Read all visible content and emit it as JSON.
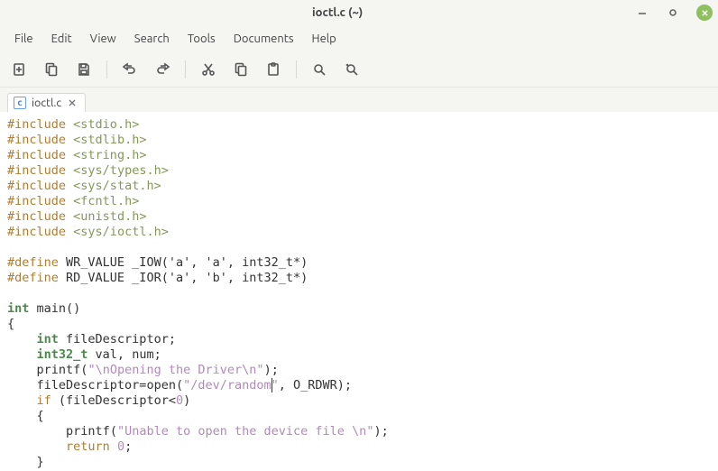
{
  "window": {
    "title": "ioctl.c (~)"
  },
  "menu": {
    "file": "File",
    "edit": "Edit",
    "view": "View",
    "search": "Search",
    "tools": "Tools",
    "documents": "Documents",
    "help": "Help"
  },
  "tab": {
    "icon_letter": "c",
    "label": "ioctl.c"
  },
  "code": {
    "include": "#include",
    "define": "#define",
    "inc_stdio": "<stdio.h>",
    "inc_stdlib": "<stdlib.h>",
    "inc_string": "<string.h>",
    "inc_types": "<sys/types.h>",
    "inc_stat": "<sys/stat.h>",
    "inc_fcntl": "<fcntl.h>",
    "inc_unistd": "<unistd.h>",
    "inc_ioctl": "<sys/ioctl.h>",
    "def_wr": " WR_VALUE _IOW('a', 'a', int32_t*)",
    "def_rd": " RD_VALUE _IOR('a', 'b', int32_t*)",
    "kw_int": "int",
    "kw_int32": "int32_t",
    "kw_if": "if",
    "kw_return": "return",
    "id_main": " main()",
    "brace_open": "{",
    "brace_close": "}",
    "indent1": "    ",
    "indent2": "        ",
    "decl_fd": " fileDescriptor;",
    "decl_val": " val, num;",
    "printf": "printf",
    "open": "open",
    "str_open_driver_pre": "\"",
    "esc_n": "\\n",
    "str_open_driver_mid": "Opening the Driver",
    "str_open_driver_post": "\"",
    "printf_open_tail": ");",
    "assign_fd_pre": "fileDescriptor=",
    "assign_fd_post": "(",
    "str_dev": "\"/dev/random",
    "str_dev_close": "\"",
    "open_tail": ", O_RDWR);",
    "if_cond": " (fileDescriptor<",
    "zero": "0",
    "if_close": ")",
    "str_unable": "\"Unable to open the device file ",
    "str_unable_close": "\"",
    "ret_sp": " ",
    "semi": ";"
  }
}
